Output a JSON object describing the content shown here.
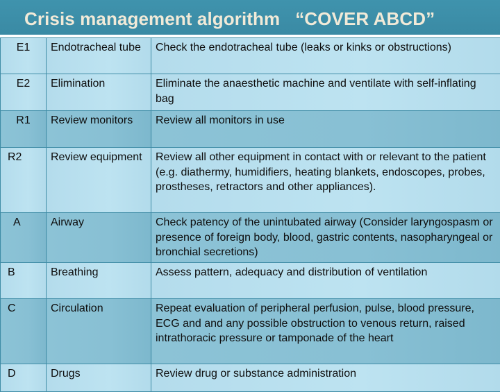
{
  "header": {
    "title": "Crisis management algorithm   “COVER ABCD”"
  },
  "table": {
    "rows": [
      {
        "code": "E1",
        "name": "Endotracheal tube",
        "description": "Check the endotracheal tube (leaks or kinks or obstructions)"
      },
      {
        "code": "E2",
        "name": "Elimination",
        "description": "Eliminate the anaesthetic machine and ventilate with self-inflating  bag"
      },
      {
        "code": "R1",
        "name": "Review monitors",
        "description": "Review all monitors in use"
      },
      {
        "code": "R2",
        "name": "Review equipment",
        "description": "Review all other equipment in contact with or relevant to the patient (e.g. diathermy, humidifiers, heating blankets, endoscopes, probes, prostheses, retractors and other appliances)."
      },
      {
        "code": "A",
        "name": "Airway",
        "description": "Check patency of the unintubated airway (Consider laryngospasm or presence of foreign body, blood, gastric contents, nasopharyngeal or bronchial secretions)"
      },
      {
        "code": "B",
        "name": "Breathing",
        "description": "Assess pattern, adequacy and distribution of ventilation"
      },
      {
        "code": "C",
        "name": "Circulation",
        "description": "Repeat evaluation of peripheral perfusion, pulse, blood pressure, ECG and  and any possible obstruction to venous return, raised intrathoracic pressure or tamponade of the heart"
      },
      {
        "code": "D",
        "name": "Drugs",
        "description": "Review drug or substance administration"
      }
    ]
  }
}
